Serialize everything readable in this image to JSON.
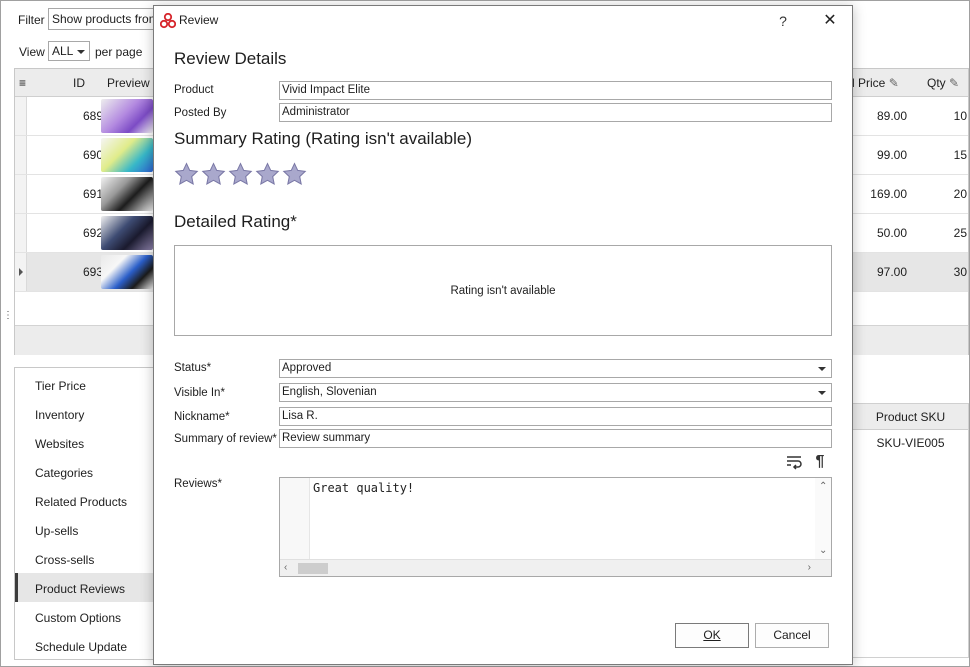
{
  "background": {
    "filter_label": "Filter",
    "filter_value": "Show products from",
    "view_label": "View",
    "view_value": "ALL",
    "per_page_label": "per page",
    "columns": {
      "id": "ID",
      "preview": "Preview",
      "price": "l Price",
      "qty": "Qty"
    },
    "rows": [
      {
        "id": "689",
        "price": "89.00",
        "qty": "10"
      },
      {
        "id": "690",
        "price": "99.00",
        "qty": "15"
      },
      {
        "id": "691",
        "price": "169.00",
        "qty": "20"
      },
      {
        "id": "692",
        "price": "50.00",
        "qty": "25"
      },
      {
        "id": "693",
        "price": "97.00",
        "qty": "30"
      }
    ],
    "side_items": [
      "Tier Price",
      "Inventory",
      "Websites",
      "Categories",
      "Related Products",
      "Up-sells",
      "Cross-sells",
      "Product Reviews",
      "Custom Options",
      "Schedule Update"
    ],
    "active_side_item": "Product Reviews",
    "sku_header": "Product SKU",
    "sku_value": "SKU-VIE005"
  },
  "dialog": {
    "title": "Review",
    "help": "?",
    "close": "✕",
    "review_details_title": "Review Details",
    "product_label": "Product",
    "product_value": "Vivid Impact Elite",
    "posted_by_label": "Posted By",
    "posted_by_value": "Administrator",
    "summary_rating_title": "Summary Rating (Rating isn't available)",
    "detailed_rating_title": "Detailed Rating*",
    "rating_unavailable": "Rating isn't available",
    "status_label": "Status*",
    "status_value": "Approved",
    "visible_in_label": "Visible In*",
    "visible_in_value": "English, Slovenian",
    "nickname_label": "Nickname*",
    "nickname_value": "Lisa R.",
    "summary_label": "Summary of review*",
    "summary_value": "Review summary",
    "reviews_label": "Reviews*",
    "reviews_value": "Great quality!",
    "ok_label": "OK",
    "cancel_label": "Cancel"
  },
  "colors": {
    "accent_red": "#d6262c",
    "star_fill": "#a9a8cc",
    "star_stroke": "#7a78a6"
  }
}
